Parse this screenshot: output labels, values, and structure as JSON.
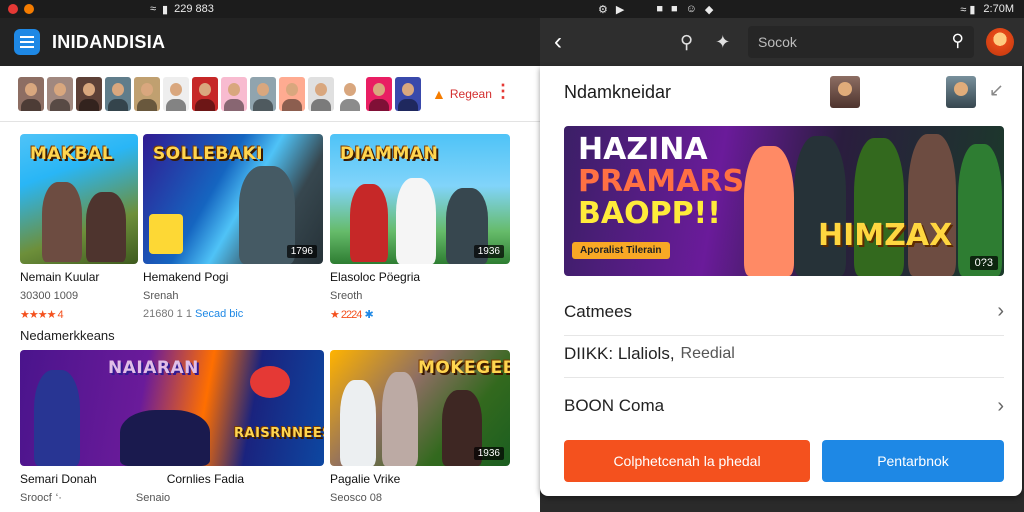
{
  "left": {
    "status_time": "229 883",
    "app_title": "INIDANDISIA",
    "avatar_strip": {
      "count": 14,
      "register_label": "Regean"
    },
    "cards_row1": [
      {
        "logo": "MAKBAL",
        "title": "Nemain Kuular",
        "meta": "30300 1009",
        "rating": "★★★★ 4",
        "duration": ""
      },
      {
        "logo": "SOLLEBAKI",
        "title": "Hemakend Pogi",
        "meta": "Srenah",
        "rating": "21680 1 1",
        "rating_alt": "Secad bic",
        "duration": "1796"
      },
      {
        "logo": "DIAMMAN",
        "title": "Elasoloc Pöegria",
        "meta": "Sreoth",
        "rating": "★ 2224",
        "rating_alt": "✱",
        "duration": "1936"
      }
    ],
    "section_title": "Nedamerkkeans",
    "cards_row2": [
      {
        "logo": "NAIARAN",
        "sub_logo": "RAISRNNEES",
        "title": "Semari Donah",
        "meta": "Sroocf",
        "meta_alt": "‘·",
        "duration": ""
      },
      {
        "logo": "MOKEGEB",
        "title": "Cornlies Fadia",
        "meta": "Senaio",
        "duration": ""
      },
      {
        "logo": "",
        "title": "Pagalie Vrike",
        "meta": "Seosco 08",
        "duration": "1936"
      }
    ]
  },
  "right": {
    "status_time": "2:70M",
    "search_placeholder": "Socok",
    "sheet_title": "Ndamkneidar",
    "banner": {
      "headline": [
        "HAZINA",
        "PRAMARS",
        "BAOPP!!"
      ],
      "tag": "Aporalist Tilerain",
      "brand": "HIMZAX",
      "duration": "0?3"
    },
    "rows": [
      {
        "label": "Catmees",
        "sub": "",
        "chevron": true
      },
      {
        "label": "DIIKK: Llaliols,",
        "sub": "Reedial",
        "chevron": false
      },
      {
        "label": "BOON  Coma",
        "sub": "",
        "chevron": true
      }
    ],
    "primary_button": "Colphetcenah la phedal",
    "secondary_button": "Pentarbnok"
  },
  "colors": {
    "primary": "#f4511e",
    "secondary": "#1e88e5",
    "appbar": "#232323"
  }
}
